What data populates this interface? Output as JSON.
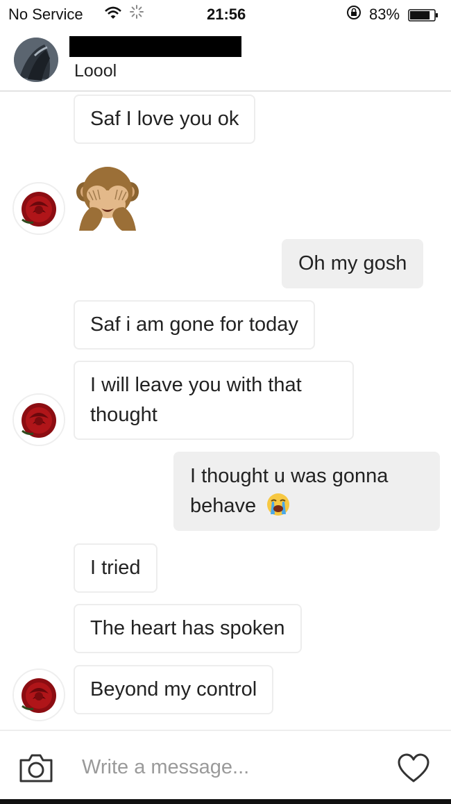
{
  "status_bar": {
    "carrier": "No Service",
    "time": "21:56",
    "battery_percent": "83%",
    "battery_level": 0.83
  },
  "header": {
    "subtitle": "Loool"
  },
  "messages": [
    {
      "direction": "received",
      "text": "Saf I love you ok"
    },
    {
      "direction": "received",
      "emoji": "see-no-evil-monkey"
    },
    {
      "direction": "sent",
      "text": "Oh my gosh"
    },
    {
      "direction": "received",
      "text": "Saf i am gone for today"
    },
    {
      "direction": "received",
      "text": "I will leave you with that thought"
    },
    {
      "direction": "sent",
      "text": "I thought u was gonna behave",
      "emoji": "loudly-crying-face"
    },
    {
      "direction": "received",
      "text": "I tried"
    },
    {
      "direction": "received",
      "text": "The heart has spoken"
    },
    {
      "direction": "received",
      "text": "Beyond my control"
    }
  ],
  "composer": {
    "placeholder": "Write a message..."
  },
  "icons": {
    "camera": "camera-icon",
    "heart": "heart-icon",
    "wifi": "wifi-icon",
    "battery": "battery-icon",
    "avatar": "rose-avatar"
  },
  "colors": {
    "sent_bubble": "#efefef",
    "received_border": "#ededed",
    "placeholder": "#9a9a9a"
  }
}
